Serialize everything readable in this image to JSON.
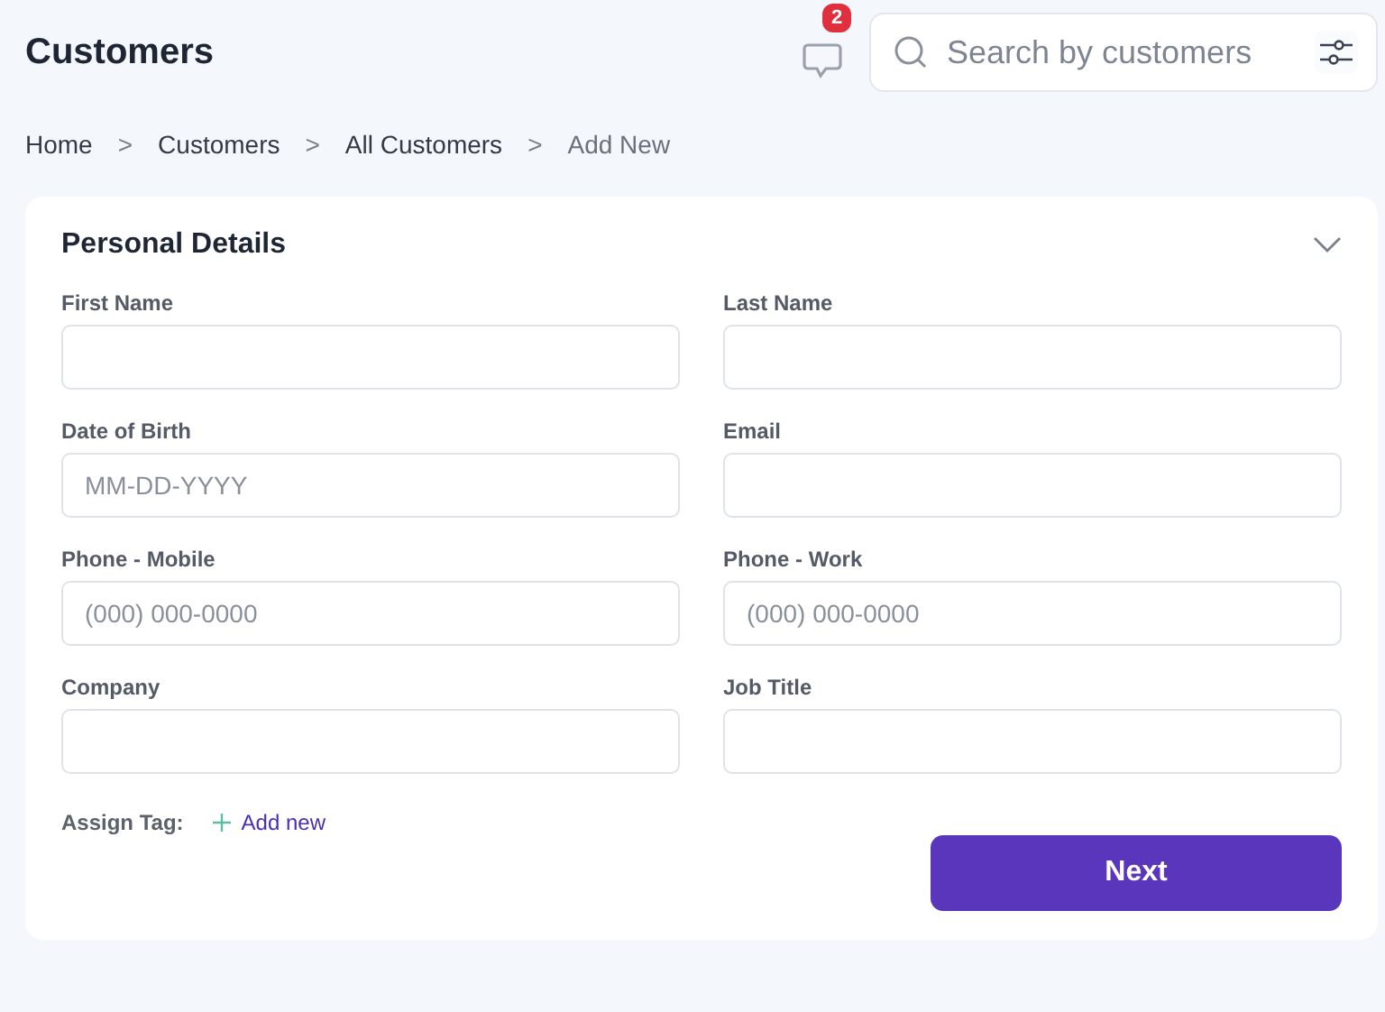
{
  "header": {
    "title": "Customers",
    "notifications": {
      "count": "2"
    },
    "search": {
      "placeholder": "Search by customers"
    }
  },
  "breadcrumb": [
    "Home",
    "Customers",
    "All Customers",
    "Add New"
  ],
  "breadcrumb_separator": ">",
  "card": {
    "title": "Personal Details",
    "expanded": true,
    "fields": [
      {
        "label": "First Name"
      },
      {
        "label": "Last Name"
      },
      {
        "label": "Date of Birth",
        "placeholder": "MM-DD-YYYY"
      },
      {
        "label": "Email"
      },
      {
        "label": "Phone - Mobile",
        "placeholder": "(000) 000-0000"
      },
      {
        "label": "Phone - Work",
        "placeholder": "(000) 000-0000"
      },
      {
        "label": "Company"
      },
      {
        "label": "Job Title"
      }
    ],
    "tag": {
      "label": "Assign Tag:",
      "link": "Add new"
    },
    "button": "Next"
  }
}
